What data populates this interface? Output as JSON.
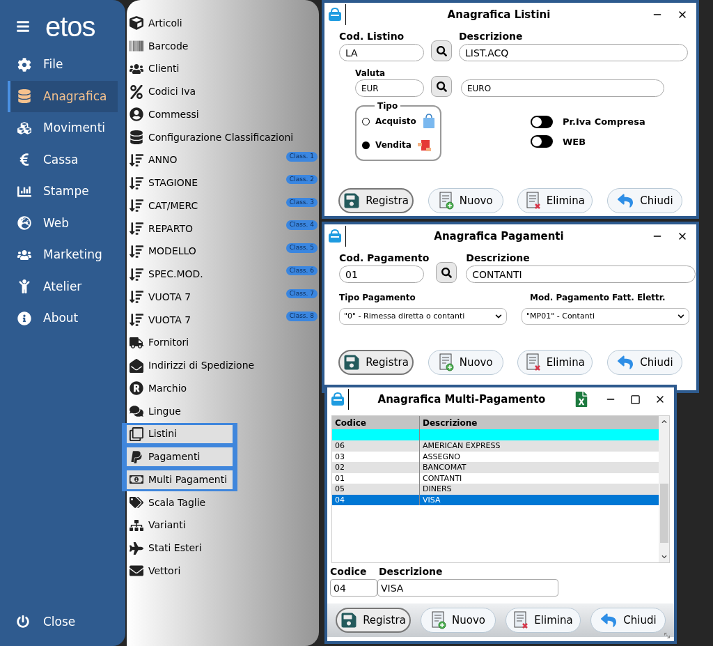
{
  "sidebar": {
    "logo": "etos",
    "items": [
      {
        "label": "File",
        "selected": false
      },
      {
        "label": "Anagrafica",
        "selected": true
      },
      {
        "label": "Movimenti",
        "selected": false
      },
      {
        "label": "Cassa",
        "selected": false
      },
      {
        "label": "Stampe",
        "selected": false
      },
      {
        "label": "Web",
        "selected": false
      },
      {
        "label": "Marketing",
        "selected": false
      },
      {
        "label": "Atelier",
        "selected": false
      },
      {
        "label": "About",
        "selected": false
      }
    ],
    "close": "Close"
  },
  "menu": {
    "items": [
      {
        "label": "Articoli",
        "kind": "item",
        "highlighted": false
      },
      {
        "label": "Barcode",
        "kind": "item",
        "highlighted": false
      },
      {
        "label": "Clienti",
        "kind": "item",
        "highlighted": false
      },
      {
        "label": "Codici Iva",
        "kind": "item",
        "highlighted": false
      },
      {
        "label": "Commessi",
        "kind": "item",
        "highlighted": false
      },
      {
        "label": "Configurazione Classificazioni",
        "kind": "item",
        "highlighted": false
      },
      {
        "label": "ANNO",
        "kind": "class",
        "badge": "Class. 1",
        "highlighted": false
      },
      {
        "label": "STAGIONE",
        "kind": "class",
        "badge": "Class. 2",
        "highlighted": false
      },
      {
        "label": "CAT/MERC",
        "kind": "class",
        "badge": "Class. 3",
        "highlighted": false
      },
      {
        "label": "REPARTO",
        "kind": "class",
        "badge": "Class. 4",
        "highlighted": false
      },
      {
        "label": "MODELLO",
        "kind": "class",
        "badge": "Class. 5",
        "highlighted": false
      },
      {
        "label": "SPEC.MOD.",
        "kind": "class",
        "badge": "Class. 6",
        "highlighted": false
      },
      {
        "label": "VUOTA 7",
        "kind": "class",
        "badge": "Class. 7",
        "highlighted": false
      },
      {
        "label": "VUOTA 7",
        "kind": "class",
        "badge": "Class. 8",
        "highlighted": false
      },
      {
        "label": "Fornitori",
        "kind": "item",
        "highlighted": false
      },
      {
        "label": "Indirizzi di Spedizione",
        "kind": "item",
        "highlighted": false
      },
      {
        "label": "Marchio",
        "kind": "item",
        "highlighted": false
      },
      {
        "label": "Lingue",
        "kind": "item",
        "highlighted": false
      },
      {
        "label": "Listini",
        "kind": "item",
        "highlighted": true
      },
      {
        "label": "Pagamenti",
        "kind": "item",
        "highlighted": true
      },
      {
        "label": "Multi Pagamenti",
        "kind": "item",
        "highlighted": true
      },
      {
        "label": "Scala Taglie",
        "kind": "item",
        "highlighted": false
      },
      {
        "label": "Varianti",
        "kind": "item",
        "highlighted": false
      },
      {
        "label": "Stati Esteri",
        "kind": "item",
        "highlighted": false
      },
      {
        "label": "Vettori",
        "kind": "item",
        "highlighted": false
      }
    ]
  },
  "listini": {
    "title": "Anagrafica Listini",
    "cod_label": "Cod. Listino",
    "cod_value": "LA",
    "desc_label": "Descrizione",
    "desc_value": "LIST.ACQ",
    "valuta_label": "Valuta",
    "valuta_value": "EUR",
    "valuta_desc": "EURO",
    "tipo": {
      "legend": "Tipo",
      "options": [
        {
          "label": "Acquisto",
          "selected": false
        },
        {
          "label": "Vendita",
          "selected": true
        }
      ]
    },
    "toggles": [
      {
        "label": "Pr.Iva Compresa",
        "on": false
      },
      {
        "label": "WEB",
        "on": false
      }
    ],
    "buttons": [
      {
        "label": "Registra",
        "kind": "save"
      },
      {
        "label": "Nuovo",
        "kind": "new"
      },
      {
        "label": "Elimina",
        "kind": "delete"
      },
      {
        "label": "Chiudi",
        "kind": "close"
      }
    ]
  },
  "pagamenti": {
    "title": "Anagrafica Pagamenti",
    "cod_label": "Cod. Pagamento",
    "cod_value": "01",
    "desc_label": "Descrizione",
    "desc_value": "CONTANTI",
    "tipo_label": "Tipo Pagamento",
    "tipo_value": "\"0\" - Rimessa diretta o contanti",
    "mod_label": "Mod. Pagamento Fatt. Elettr.",
    "mod_value": "\"MP01\" - Contanti",
    "buttons": [
      {
        "label": "Registra",
        "kind": "save"
      },
      {
        "label": "Nuovo",
        "kind": "new"
      },
      {
        "label": "Elimina",
        "kind": "delete"
      },
      {
        "label": "Chiudi",
        "kind": "close"
      }
    ]
  },
  "multi": {
    "title": "Anagrafica Multi-Pagamento",
    "table": {
      "columns": [
        "Codice",
        "Descrizione"
      ],
      "new_row": true,
      "rows": [
        {
          "codice": "06",
          "descrizione": "AMERICAN EXPRESS",
          "selected": false
        },
        {
          "codice": "03",
          "descrizione": "ASSEGNO",
          "selected": false
        },
        {
          "codice": "02",
          "descrizione": "BANCOMAT",
          "selected": false
        },
        {
          "codice": "01",
          "descrizione": "CONTANTI",
          "selected": false
        },
        {
          "codice": "05",
          "descrizione": "DINERS",
          "selected": false
        },
        {
          "codice": "04",
          "descrizione": "VISA",
          "selected": true
        }
      ]
    },
    "cod_label": "Codice",
    "cod_value": "04",
    "desc_label": "Descrizione",
    "desc_value": "VISA",
    "buttons": [
      {
        "label": "Registra",
        "kind": "save"
      },
      {
        "label": "Nuovo",
        "kind": "new"
      },
      {
        "label": "Elimina",
        "kind": "delete"
      },
      {
        "label": "Chiudi",
        "kind": "close"
      }
    ]
  }
}
